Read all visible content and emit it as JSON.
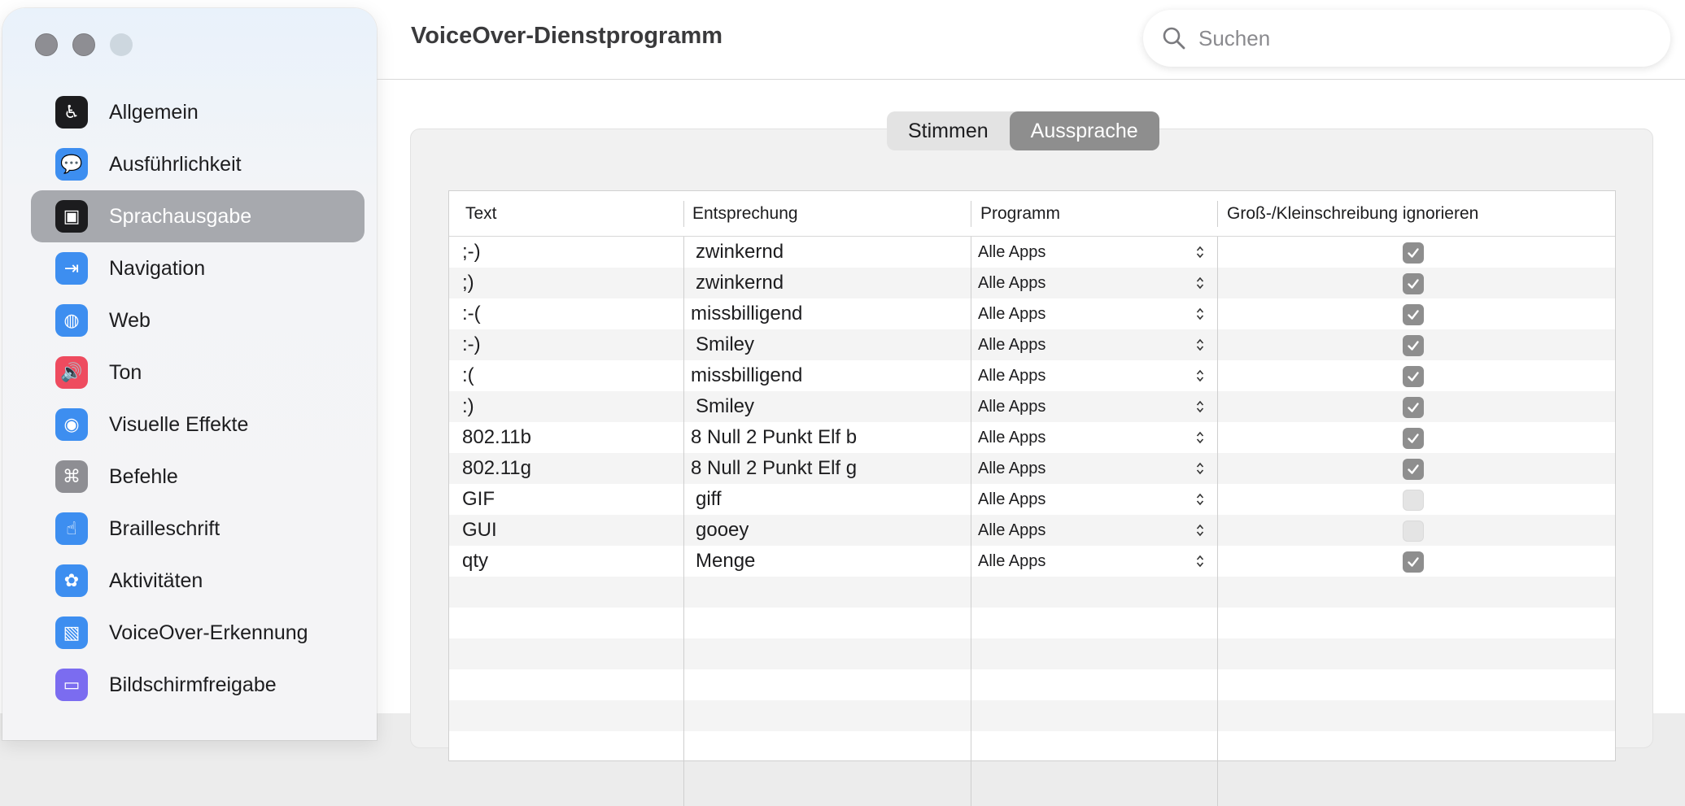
{
  "window": {
    "title": "VoiceOver-Dienstprogramm"
  },
  "search": {
    "placeholder": "Suchen"
  },
  "sidebar": {
    "items": [
      {
        "label": "Allgemein",
        "icon": "accessibility-icon",
        "color": "#1c1c1e"
      },
      {
        "label": "Ausführlichkeit",
        "icon": "speech-bubble-icon",
        "color": "#3d8ef0"
      },
      {
        "label": "Sprachausgabe",
        "icon": "speech-bubble-dark-icon",
        "color": "#1c1c1e",
        "active": true
      },
      {
        "label": "Navigation",
        "icon": "arrow-right-bar-icon",
        "color": "#3d8ef0"
      },
      {
        "label": "Web",
        "icon": "globe-icon",
        "color": "#3d8ef0"
      },
      {
        "label": "Ton",
        "icon": "speaker-icon",
        "color": "#ee4b5f"
      },
      {
        "label": "Visuelle Effekte",
        "icon": "eye-icon",
        "color": "#3d8ef0"
      },
      {
        "label": "Befehle",
        "icon": "command-icon",
        "color": "#8e8e93"
      },
      {
        "label": "Brailleschrift",
        "icon": "braille-hand-icon",
        "color": "#3d8ef0"
      },
      {
        "label": "Aktivitäten",
        "icon": "activities-icon",
        "color": "#3d8ef0"
      },
      {
        "label": "VoiceOver-Erkennung",
        "icon": "image-recognition-icon",
        "color": "#3d8ef0"
      },
      {
        "label": "Bildschirmfreigabe",
        "icon": "screen-share-icon",
        "color": "#7b6cf0"
      }
    ]
  },
  "tabs": [
    {
      "label": "Stimmen",
      "selected": false
    },
    {
      "label": "Aussprache",
      "selected": true
    }
  ],
  "table": {
    "headers": [
      "Text",
      "Entsprechung",
      "Programm",
      "Groß-/Kleinschreibung ignorieren"
    ],
    "rows": [
      {
        "text": ";-)",
        "sub": "zwinkernd",
        "app": "Alle Apps",
        "ignore": true
      },
      {
        "text": ";)",
        "sub": "zwinkernd",
        "app": "Alle Apps",
        "ignore": true
      },
      {
        "text": ":-(",
        "sub": "missbilligend",
        "app": "Alle Apps",
        "ignore": true
      },
      {
        "text": ":-)",
        "sub": "Smiley",
        "app": "Alle Apps",
        "ignore": true
      },
      {
        "text": ":(",
        "sub": "missbilligend",
        "app": "Alle Apps",
        "ignore": true
      },
      {
        "text": ":)",
        "sub": "Smiley",
        "app": "Alle Apps",
        "ignore": true
      },
      {
        "text": "802.11b",
        "sub": "8 Null 2 Punkt Elf b",
        "app": "Alle Apps",
        "ignore": true
      },
      {
        "text": "802.11g",
        "sub": "8 Null 2 Punkt Elf g",
        "app": "Alle Apps",
        "ignore": true
      },
      {
        "text": "GIF",
        "sub": "giff",
        "app": "Alle Apps",
        "ignore": false
      },
      {
        "text": "GUI",
        "sub": "gooey",
        "app": "Alle Apps",
        "ignore": false
      },
      {
        "text": "qty",
        "sub": "Menge",
        "app": "Alle Apps",
        "ignore": true
      }
    ]
  }
}
